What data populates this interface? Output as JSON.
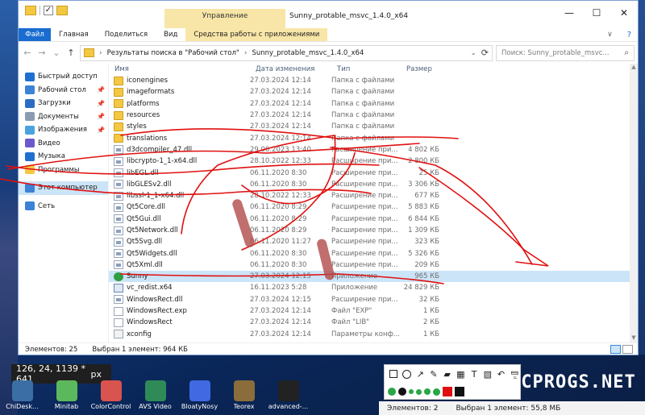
{
  "window": {
    "title": "Sunny_protable_msvc_1.4.0_x64",
    "context_group": "Управление",
    "tabs": [
      "Файл",
      "Главная",
      "Поделиться",
      "Вид",
      "Средства работы с приложениями"
    ],
    "expand_glyph": "∨",
    "help_glyph": "?",
    "controls": [
      "—",
      "☐",
      "✕"
    ]
  },
  "address": {
    "segments": [
      "Результаты поиска в \"Рабочий стол\"",
      "Sunny_protable_msvc_1.4.0_x64"
    ],
    "separator": "›",
    "search_placeholder": "Поиск: Sunny_protable_msvc..."
  },
  "nav_pane": [
    {
      "label": "Быстрый доступ",
      "icon": "star-icon",
      "color": "#1f6fd1",
      "pinned": false,
      "selected": false
    },
    {
      "label": "Рабочий стол",
      "icon": "desktop-icon",
      "color": "#3c82d6",
      "pinned": true,
      "selected": false
    },
    {
      "label": "Загрузки",
      "icon": "download-icon",
      "color": "#2b6cc4",
      "pinned": true,
      "selected": false
    },
    {
      "label": "Документы",
      "icon": "document-icon",
      "color": "#8a9bb3",
      "pinned": true,
      "selected": false
    },
    {
      "label": "Изображения",
      "icon": "image-icon",
      "color": "#4aa3df",
      "pinned": true,
      "selected": false
    },
    {
      "label": "Видео",
      "icon": "video-icon",
      "color": "#6a5acd",
      "pinned": false,
      "selected": false
    },
    {
      "label": "Музыка",
      "icon": "music-icon",
      "color": "#1f6fd1",
      "pinned": false,
      "selected": false
    },
    {
      "label": "Программы",
      "icon": "folder-icon",
      "color": "#f5c842",
      "pinned": false,
      "selected": false
    },
    {
      "label": "Этот компьютер",
      "icon": "computer-icon",
      "color": "#3c82d6",
      "pinned": false,
      "selected": true
    },
    {
      "label": "Сеть",
      "icon": "network-icon",
      "color": "#3c82d6",
      "pinned": false,
      "selected": false
    }
  ],
  "pin_glyph": "📌",
  "columns": {
    "name": "Имя",
    "date": "Дата изменения",
    "type": "Тип",
    "size": "Размер"
  },
  "files": [
    {
      "name": "iconengines",
      "date": "27.03.2024 12:14",
      "type": "Папка с файлами",
      "size": "",
      "kind": "folder"
    },
    {
      "name": "imageformats",
      "date": "27.03.2024 12:14",
      "type": "Папка с файлами",
      "size": "",
      "kind": "folder"
    },
    {
      "name": "platforms",
      "date": "27.03.2024 12:14",
      "type": "Папка с файлами",
      "size": "",
      "kind": "folder"
    },
    {
      "name": "resources",
      "date": "27.03.2024 12:14",
      "type": "Папка с файлами",
      "size": "",
      "kind": "folder"
    },
    {
      "name": "styles",
      "date": "27.03.2024 12:14",
      "type": "Папка с файлами",
      "size": "",
      "kind": "folder"
    },
    {
      "name": "translations",
      "date": "27.03.2024 12:14",
      "type": "Папка с файлами",
      "size": "",
      "kind": "folder"
    },
    {
      "name": "d3dcompiler_47.dll",
      "date": "29.06.2023 13:40",
      "type": "Расширение при...",
      "size": "4 802 КБ",
      "kind": "dll"
    },
    {
      "name": "libcrypto-1_1-x64.dll",
      "date": "28.10.2022 12:33",
      "type": "Расширение при...",
      "size": "2 800 КБ",
      "kind": "dll"
    },
    {
      "name": "libEGL.dll",
      "date": "06.11.2020 8:30",
      "type": "Расширение при...",
      "size": "25 КБ",
      "kind": "dll"
    },
    {
      "name": "libGLESv2.dll",
      "date": "06.11.2020 8:30",
      "type": "Расширение при...",
      "size": "3 306 КБ",
      "kind": "dll"
    },
    {
      "name": "libssl-1_1-x64.dll",
      "date": "28.10.2022 12:33",
      "type": "Расширение при...",
      "size": "677 КБ",
      "kind": "dll"
    },
    {
      "name": "Qt5Core.dll",
      "date": "06.11.2020 8:29",
      "type": "Расширение при...",
      "size": "5 883 КБ",
      "kind": "dll"
    },
    {
      "name": "Qt5Gui.dll",
      "date": "06.11.2020 8:29",
      "type": "Расширение при...",
      "size": "6 844 КБ",
      "kind": "dll"
    },
    {
      "name": "Qt5Network.dll",
      "date": "06.11.2020 8:29",
      "type": "Расширение при...",
      "size": "1 309 КБ",
      "kind": "dll"
    },
    {
      "name": "Qt5Svg.dll",
      "date": "06.11.2020 11:27",
      "type": "Расширение при...",
      "size": "323 КБ",
      "kind": "dll"
    },
    {
      "name": "Qt5Widgets.dll",
      "date": "06.11.2020 8:30",
      "type": "Расширение при...",
      "size": "5 326 КБ",
      "kind": "dll"
    },
    {
      "name": "Qt5Xml.dll",
      "date": "06.11.2020 8:30",
      "type": "Расширение при...",
      "size": "209 КБ",
      "kind": "dll"
    },
    {
      "name": "Sunny",
      "date": "27.03.2024 12:15",
      "type": "Приложение",
      "size": "965 КБ",
      "kind": "exe",
      "selected": true
    },
    {
      "name": "vc_redist.x64",
      "date": "16.11.2023 5:28",
      "type": "Приложение",
      "size": "24 829 КБ",
      "kind": "app"
    },
    {
      "name": "WindowsRect.dll",
      "date": "27.03.2024 12:15",
      "type": "Расширение при...",
      "size": "32 КБ",
      "kind": "dll"
    },
    {
      "name": "WindowsRect.exp",
      "date": "27.03.2024 12:14",
      "type": "Файл \"EXP\"",
      "size": "1 КБ",
      "kind": "gen"
    },
    {
      "name": "WindowsRect",
      "date": "27.03.2024 12:14",
      "type": "Файл \"LIB\"",
      "size": "2 КБ",
      "kind": "gen"
    },
    {
      "name": "xconfig",
      "date": "27.03.2024 12:14",
      "type": "Параметры конф...",
      "size": "1 КБ",
      "kind": "cfg"
    }
  ],
  "status": {
    "count": "Элементов: 25",
    "selection": "Выбран 1 элемент: 964 КБ"
  },
  "desktop": {
    "snip_coords": "126, 24, 1139 * 641",
    "snip_unit": "px",
    "icons": [
      {
        "label": "ChiDesk...",
        "color": "#3a6ea5"
      },
      {
        "label": "Minitab",
        "color": "#5cb85c"
      },
      {
        "label": "ColorControl",
        "color": "#d9534f"
      },
      {
        "label": "AVS Video",
        "color": "#2e8b57"
      },
      {
        "label": "BloatyNosy",
        "color": "#4169e1"
      },
      {
        "label": "Teorex",
        "color": "#8a6d3b"
      },
      {
        "label": "advanced-...",
        "color": "#222222"
      }
    ],
    "status_items": [
      "Элементов: 2",
      "Выбран 1 элемент: 55,8 МБ"
    ],
    "brand": "PCPROGS.NET"
  },
  "annotation_tools": {
    "row1": [
      "rect-tool-icon",
      "ellipse-tool-icon",
      "arrow-tool-icon",
      "pen-tool-icon",
      "marker-tool-icon",
      "mosaic-tool-icon",
      "text-tool-icon",
      "blur-tool-icon",
      "undo-icon",
      "save-icon"
    ],
    "row1_glyphs": [
      "",
      "",
      "↗",
      "✎",
      "▰",
      "▦",
      "T",
      "▧",
      "↶",
      "▤"
    ],
    "colors": [
      "#28a745",
      "#111111",
      "#28a745",
      "#28a745",
      "#28a745",
      "#28a745",
      "#e01010",
      "#111111"
    ]
  }
}
